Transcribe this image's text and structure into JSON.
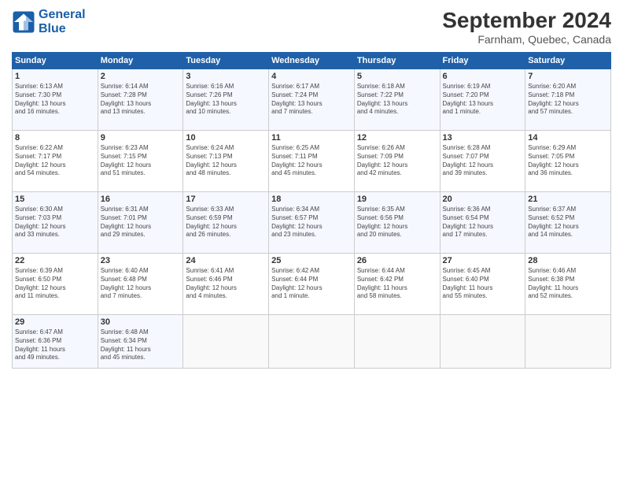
{
  "header": {
    "logo_line1": "General",
    "logo_line2": "Blue",
    "month": "September 2024",
    "location": "Farnham, Quebec, Canada"
  },
  "columns": [
    "Sunday",
    "Monday",
    "Tuesday",
    "Wednesday",
    "Thursday",
    "Friday",
    "Saturday"
  ],
  "rows": [
    [
      {
        "day": "1",
        "info": "Sunrise: 6:13 AM\nSunset: 7:30 PM\nDaylight: 13 hours\nand 16 minutes."
      },
      {
        "day": "2",
        "info": "Sunrise: 6:14 AM\nSunset: 7:28 PM\nDaylight: 13 hours\nand 13 minutes."
      },
      {
        "day": "3",
        "info": "Sunrise: 6:16 AM\nSunset: 7:26 PM\nDaylight: 13 hours\nand 10 minutes."
      },
      {
        "day": "4",
        "info": "Sunrise: 6:17 AM\nSunset: 7:24 PM\nDaylight: 13 hours\nand 7 minutes."
      },
      {
        "day": "5",
        "info": "Sunrise: 6:18 AM\nSunset: 7:22 PM\nDaylight: 13 hours\nand 4 minutes."
      },
      {
        "day": "6",
        "info": "Sunrise: 6:19 AM\nSunset: 7:20 PM\nDaylight: 13 hours\nand 1 minute."
      },
      {
        "day": "7",
        "info": "Sunrise: 6:20 AM\nSunset: 7:18 PM\nDaylight: 12 hours\nand 57 minutes."
      }
    ],
    [
      {
        "day": "8",
        "info": "Sunrise: 6:22 AM\nSunset: 7:17 PM\nDaylight: 12 hours\nand 54 minutes."
      },
      {
        "day": "9",
        "info": "Sunrise: 6:23 AM\nSunset: 7:15 PM\nDaylight: 12 hours\nand 51 minutes."
      },
      {
        "day": "10",
        "info": "Sunrise: 6:24 AM\nSunset: 7:13 PM\nDaylight: 12 hours\nand 48 minutes."
      },
      {
        "day": "11",
        "info": "Sunrise: 6:25 AM\nSunset: 7:11 PM\nDaylight: 12 hours\nand 45 minutes."
      },
      {
        "day": "12",
        "info": "Sunrise: 6:26 AM\nSunset: 7:09 PM\nDaylight: 12 hours\nand 42 minutes."
      },
      {
        "day": "13",
        "info": "Sunrise: 6:28 AM\nSunset: 7:07 PM\nDaylight: 12 hours\nand 39 minutes."
      },
      {
        "day": "14",
        "info": "Sunrise: 6:29 AM\nSunset: 7:05 PM\nDaylight: 12 hours\nand 36 minutes."
      }
    ],
    [
      {
        "day": "15",
        "info": "Sunrise: 6:30 AM\nSunset: 7:03 PM\nDaylight: 12 hours\nand 33 minutes."
      },
      {
        "day": "16",
        "info": "Sunrise: 6:31 AM\nSunset: 7:01 PM\nDaylight: 12 hours\nand 29 minutes."
      },
      {
        "day": "17",
        "info": "Sunrise: 6:33 AM\nSunset: 6:59 PM\nDaylight: 12 hours\nand 26 minutes."
      },
      {
        "day": "18",
        "info": "Sunrise: 6:34 AM\nSunset: 6:57 PM\nDaylight: 12 hours\nand 23 minutes."
      },
      {
        "day": "19",
        "info": "Sunrise: 6:35 AM\nSunset: 6:56 PM\nDaylight: 12 hours\nand 20 minutes."
      },
      {
        "day": "20",
        "info": "Sunrise: 6:36 AM\nSunset: 6:54 PM\nDaylight: 12 hours\nand 17 minutes."
      },
      {
        "day": "21",
        "info": "Sunrise: 6:37 AM\nSunset: 6:52 PM\nDaylight: 12 hours\nand 14 minutes."
      }
    ],
    [
      {
        "day": "22",
        "info": "Sunrise: 6:39 AM\nSunset: 6:50 PM\nDaylight: 12 hours\nand 11 minutes."
      },
      {
        "day": "23",
        "info": "Sunrise: 6:40 AM\nSunset: 6:48 PM\nDaylight: 12 hours\nand 7 minutes."
      },
      {
        "day": "24",
        "info": "Sunrise: 6:41 AM\nSunset: 6:46 PM\nDaylight: 12 hours\nand 4 minutes."
      },
      {
        "day": "25",
        "info": "Sunrise: 6:42 AM\nSunset: 6:44 PM\nDaylight: 12 hours\nand 1 minute."
      },
      {
        "day": "26",
        "info": "Sunrise: 6:44 AM\nSunset: 6:42 PM\nDaylight: 11 hours\nand 58 minutes."
      },
      {
        "day": "27",
        "info": "Sunrise: 6:45 AM\nSunset: 6:40 PM\nDaylight: 11 hours\nand 55 minutes."
      },
      {
        "day": "28",
        "info": "Sunrise: 6:46 AM\nSunset: 6:38 PM\nDaylight: 11 hours\nand 52 minutes."
      }
    ],
    [
      {
        "day": "29",
        "info": "Sunrise: 6:47 AM\nSunset: 6:36 PM\nDaylight: 11 hours\nand 49 minutes."
      },
      {
        "day": "30",
        "info": "Sunrise: 6:48 AM\nSunset: 6:34 PM\nDaylight: 11 hours\nand 45 minutes."
      },
      {
        "day": "",
        "info": ""
      },
      {
        "day": "",
        "info": ""
      },
      {
        "day": "",
        "info": ""
      },
      {
        "day": "",
        "info": ""
      },
      {
        "day": "",
        "info": ""
      }
    ]
  ]
}
